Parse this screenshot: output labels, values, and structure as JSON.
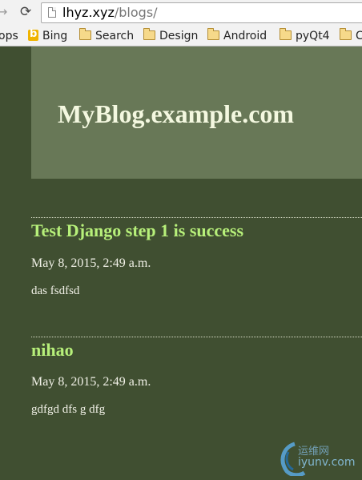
{
  "browser": {
    "url_host": "lhyz.xyz",
    "url_path": "/blogs/",
    "bookmarks": [
      {
        "label": "ops",
        "icon": "none"
      },
      {
        "label": "Bing",
        "icon": "bing-icon"
      },
      {
        "label": "Search",
        "icon": "folder-icon"
      },
      {
        "label": "Design",
        "icon": "folder-icon"
      },
      {
        "label": "Android",
        "icon": "folder-icon"
      },
      {
        "label": "pyQt4",
        "icon": "folder-icon"
      },
      {
        "label": "C",
        "icon": "folder-icon"
      }
    ]
  },
  "site": {
    "title": "MyBlog.example.com"
  },
  "posts": [
    {
      "title": "Test Django step 1 is success",
      "date": "May 8, 2015, 2:49 a.m.",
      "body": "das fsdfsd"
    },
    {
      "title": "nihao",
      "date": "May 8, 2015, 2:49 a.m.",
      "body": "gdfgd dfs g dfg"
    }
  ],
  "watermark": {
    "line1": "运维网",
    "line2": "iyunv.com"
  },
  "colors": {
    "page_background": "#404f31",
    "header_background": "#687857",
    "title_text": "#f4f8e0",
    "post_title": "#b7f07a",
    "post_text": "#f0f0e6"
  }
}
